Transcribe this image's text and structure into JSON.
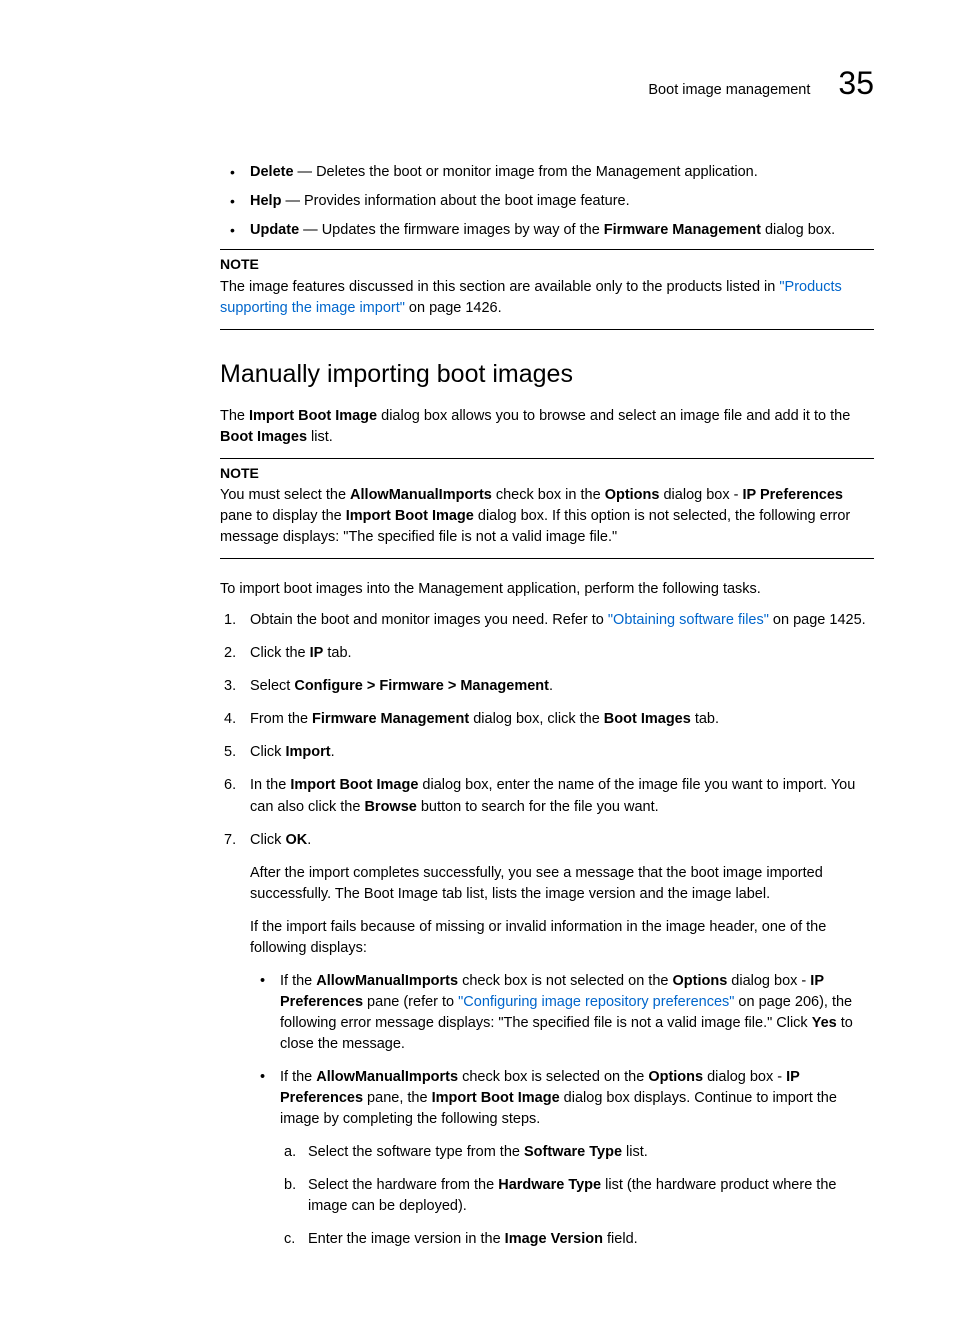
{
  "header": {
    "title": "Boot image management",
    "chapter": "35"
  },
  "topBullets": {
    "delete": {
      "label": "Delete",
      "text": " — Deletes the boot or monitor image from the Management application."
    },
    "help": {
      "label": "Help",
      "text": " — Provides information about the boot image feature."
    },
    "update": {
      "label": "Update",
      "pre": " — Updates the firmware images by way of the ",
      "fm": "Firmware Management",
      "post": " dialog box."
    }
  },
  "note1": {
    "label": "NOTE",
    "pre": "The image features discussed in this section are available only to the products listed in ",
    "link": "\"Products supporting the image import\"",
    "post": " on page 1426."
  },
  "h2": "Manually importing boot images",
  "intro": {
    "pre": "The ",
    "b1": "Import Boot Image",
    "mid": " dialog box allows you to browse and select an image file and add it to the ",
    "b2": "Boot Images",
    "post": " list."
  },
  "note2": {
    "label": "NOTE",
    "a": "You must select the ",
    "b_allow": "AllowManualImports",
    "c": " check box in the ",
    "b_opt": "Options",
    "d": " dialog box - ",
    "b_ip": "IP Preferences",
    "e": " pane to display the ",
    "b_ibi": "Import Boot Image",
    "f": " dialog box. If this option is not selected, the following error message displays: \"The specified file is not a valid image file.\""
  },
  "leadIn": "To import boot images into the Management application, perform the following tasks.",
  "steps": {
    "s1": {
      "pre": "Obtain the boot and monitor images you need. Refer to ",
      "link": "\"Obtaining software files\"",
      "post": " on page 1425."
    },
    "s2": {
      "pre": "Click the ",
      "b": "IP",
      "post": " tab."
    },
    "s3": {
      "pre": "Select ",
      "b": "Configure > Firmware > Management",
      "post": "."
    },
    "s4": {
      "pre": "From the ",
      "b1": "Firmware Management",
      "mid": " dialog box, click the ",
      "b2": "Boot Images",
      "post": " tab."
    },
    "s5": {
      "pre": "Click ",
      "b": "Import",
      "post": "."
    },
    "s6": {
      "pre": "In the ",
      "b1": "Import Boot Image",
      "mid": " dialog box, enter the name of the image file you want to import. You can also click the ",
      "b2": "Browse",
      "post": " button to search for the file you want."
    },
    "s7": {
      "pre": "Click ",
      "b": "OK",
      "post": ".",
      "p1": "After the import completes successfully, you see a message that the boot image imported successfully. The Boot Image tab list, lists the image version and the image label.",
      "p2": "If the import fails because of missing or invalid information in the image header, one of the following displays:",
      "sub1": {
        "a": "If the ",
        "b_allow": "AllowManualImports",
        "c": " check box is not selected on the ",
        "b_opt": "Options",
        "d": " dialog box - ",
        "b_ip": "IP Preferences",
        "e": " pane (refer to ",
        "link": "\"Configuring image repository preferences\"",
        "f": " on page 206), the following error message displays: \"The specified file is not a valid image file.\" Click ",
        "b_yes": "Yes",
        "g": " to close the message."
      },
      "sub2": {
        "a": "If the ",
        "b_allow": "AllowManualImports",
        "c": " check box is selected on the ",
        "b_opt": "Options",
        "d": " dialog box - ",
        "b_ip": "IP Preferences",
        "e": " pane, the ",
        "b_ibi": "Import Boot Image",
        "f": " dialog box displays. Continue to import the image by completing the following steps.",
        "la": {
          "pre": "Select the software type from the ",
          "b": "Software Type",
          "post": " list."
        },
        "lb": {
          "pre": "Select the hardware from the ",
          "b": "Hardware Type",
          "post": " list (the hardware product where the image can be deployed)."
        },
        "lc": {
          "pre": "Enter the image version in the ",
          "b": "Image Version",
          "post": " field."
        }
      }
    }
  }
}
